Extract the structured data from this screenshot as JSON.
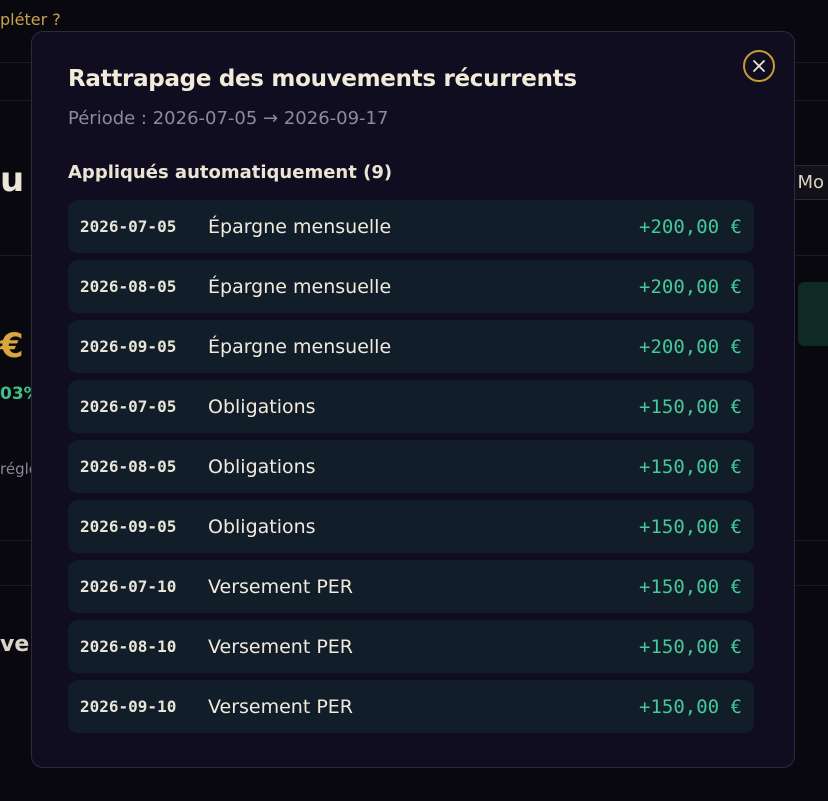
{
  "background": {
    "hint": "pléter ?",
    "letter": "u",
    "euro": "€",
    "pct": "03%",
    "regle": "réglé",
    "velo": "velo",
    "mo": "Mo"
  },
  "modal": {
    "title": "Rattrapage des mouvements récurrents",
    "period": "Période : 2026-07-05 → 2026-09-17",
    "section_title": "Appliqués automatiquement (9)",
    "close_label": "×"
  },
  "rows": [
    {
      "date": "2026-07-05",
      "label": "Épargne mensuelle",
      "amount": "+200,00 €"
    },
    {
      "date": "2026-08-05",
      "label": "Épargne mensuelle",
      "amount": "+200,00 €"
    },
    {
      "date": "2026-09-05",
      "label": "Épargne mensuelle",
      "amount": "+200,00 €"
    },
    {
      "date": "2026-07-05",
      "label": "Obligations",
      "amount": "+150,00 €"
    },
    {
      "date": "2026-08-05",
      "label": "Obligations",
      "amount": "+150,00 €"
    },
    {
      "date": "2026-09-05",
      "label": "Obligations",
      "amount": "+150,00 €"
    },
    {
      "date": "2026-07-10",
      "label": "Versement PER",
      "amount": "+150,00 €"
    },
    {
      "date": "2026-08-10",
      "label": "Versement PER",
      "amount": "+150,00 €"
    },
    {
      "date": "2026-09-10",
      "label": "Versement PER",
      "amount": "+150,00 €"
    }
  ],
  "colors": {
    "accent": "#c89a34",
    "positive": "#44c99a",
    "modal_bg": "#0f0d1f",
    "row_bg": "#111d29"
  }
}
